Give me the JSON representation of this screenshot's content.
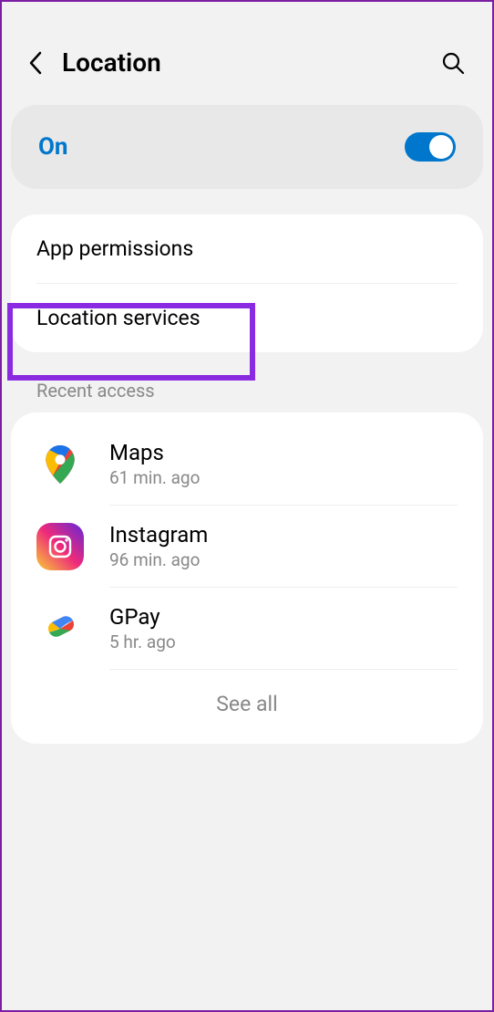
{
  "header": {
    "title": "Location"
  },
  "toggle": {
    "label": "On",
    "state": true
  },
  "menu": {
    "appPermissions": "App permissions",
    "locationServices": "Location services"
  },
  "section": {
    "recentAccess": "Recent access"
  },
  "recent": [
    {
      "name": "Maps",
      "time": "61 min. ago",
      "icon": "maps"
    },
    {
      "name": "Instagram",
      "time": "96 min. ago",
      "icon": "instagram"
    },
    {
      "name": "GPay",
      "time": "5 hr. ago",
      "icon": "gpay"
    }
  ],
  "seeAll": "See all"
}
